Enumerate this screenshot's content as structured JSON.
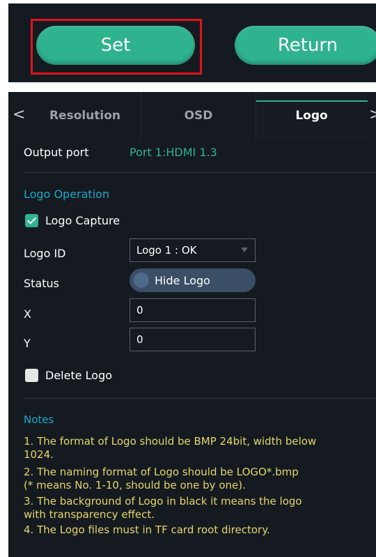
{
  "buttons": {
    "set_label": "Set",
    "return_label": "Return"
  },
  "tabs": {
    "left_arrow": "<",
    "right_arrow": ">",
    "items": [
      {
        "label": "Resolution"
      },
      {
        "label": "OSD"
      },
      {
        "label": "Logo",
        "active": true
      }
    ]
  },
  "output_port": {
    "label": "Output port",
    "value": "Port 1:HDMI 1.3"
  },
  "logo_operation": {
    "title": "Logo Operation",
    "capture": {
      "label": "Logo Capture",
      "checked": true
    },
    "logo_id": {
      "label": "Logo ID",
      "value": "Logo 1 : OK"
    },
    "status": {
      "label": "Status",
      "toggle_label": "Hide Logo"
    },
    "x": {
      "label": "X",
      "value": "0"
    },
    "y": {
      "label": "Y",
      "value": "0"
    },
    "delete": {
      "label": "Delete Logo",
      "checked": false
    }
  },
  "notes": {
    "title": "Notes",
    "lines": [
      "1. The format of Logo should be BMP 24bit, width below",
      "1024.",
      "2. The naming format of Logo should be LOGO*.bmp",
      "(* means No. 1-10, should be one by one).",
      "3. The background of Logo in black it means the logo",
      "with transparency effect.",
      "4. The Logo files must in TF card root directory."
    ]
  },
  "colors": {
    "accent": "#2fb38e",
    "panel_bg": "#141a20",
    "highlight_border": "#e0141c",
    "section_title": "#1ba8c8",
    "notes_text": "#e6d66a"
  }
}
